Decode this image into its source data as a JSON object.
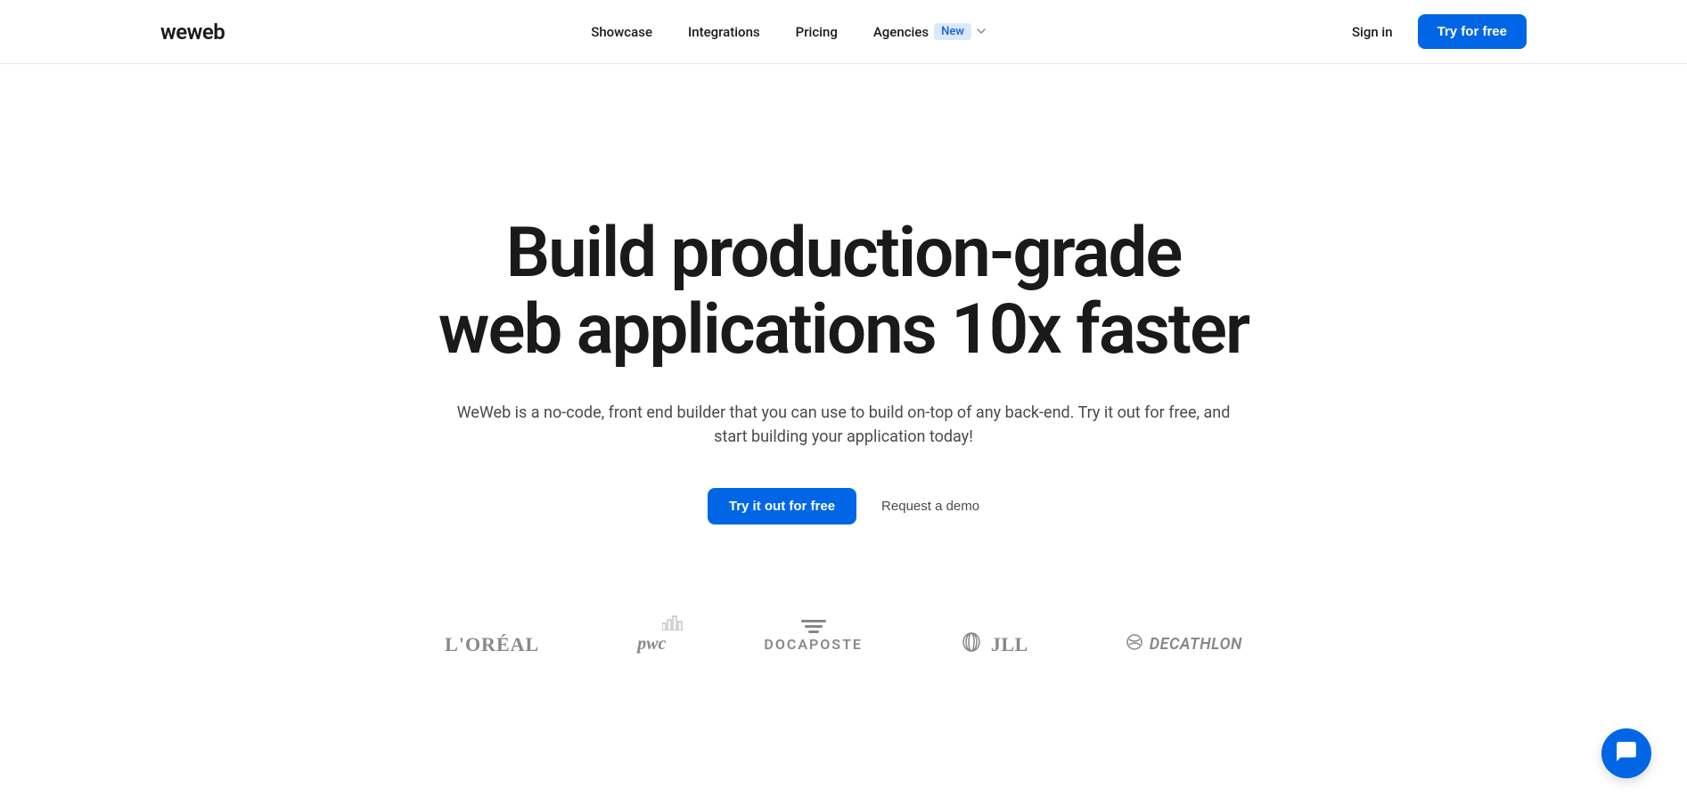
{
  "header": {
    "logo": "weweb",
    "nav": {
      "showcase": "Showcase",
      "integrations": "Integrations",
      "pricing": "Pricing",
      "agencies": "Agencies",
      "agencies_badge": "New"
    },
    "sign_in": "Sign in",
    "try_free": "Try for free"
  },
  "hero": {
    "title_line1": "Build production-grade",
    "title_line2": "web applications 10x faster",
    "subtitle": "WeWeb is a no-code, front end builder that you can use to build on-top of any back-end. Try it out for free, and start building your application today!",
    "try_button": "Try it out for free",
    "demo_button": "Request a demo"
  },
  "logos": {
    "loreal": "L'ORÉAL",
    "pwc": "pwc",
    "docaposte": "DOCAPOSTE",
    "jll": "JLL",
    "decathlon": "DECATHLON"
  }
}
